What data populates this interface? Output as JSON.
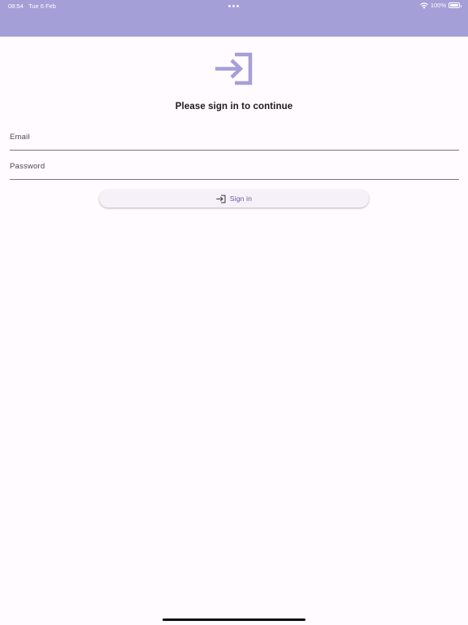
{
  "status_bar": {
    "time": "08:54",
    "date": "Tue 6 Feb",
    "battery": "100%",
    "icons": [
      "multitasking-dots-icon",
      "wifi-icon",
      "battery-icon"
    ]
  },
  "colors": {
    "app_bar": "#a59fd8",
    "background": "#fffbfe",
    "accent": "#6750a4",
    "icon": "#a59fd8"
  },
  "main": {
    "hero_icon": "login-icon",
    "title": "Please sign in to continue",
    "email": {
      "label": "Email",
      "value": ""
    },
    "password": {
      "label": "Password",
      "value": ""
    },
    "signin_button": {
      "icon": "login-icon",
      "label": "Sign in"
    }
  }
}
